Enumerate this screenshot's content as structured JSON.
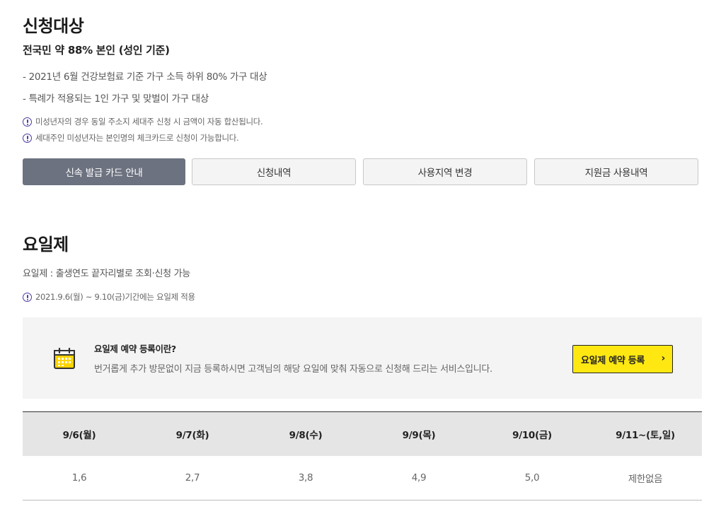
{
  "eligibility": {
    "title": "신청대상",
    "subtitle": "전국민 약 88% 본인 (성인 기준)",
    "bullets": [
      "- 2021년 6월 건강보험료 기준 가구 소득 하위 80% 가구 대상",
      "- 특례가 적용되는 1인 가구 및 맞벌이 가구 대상"
    ],
    "notes": [
      "미성년자의 경우 동일 주소지 세대주 신청 시 금액이 자동 합산됩니다.",
      "세대주인 미성년자는 본인명의 체크카드로 신청이 가능합니다."
    ]
  },
  "tabs": [
    {
      "label": "신속 발급 카드 안내",
      "active": true
    },
    {
      "label": "신청내역",
      "active": false
    },
    {
      "label": "사용지역 변경",
      "active": false
    },
    {
      "label": "지원금 사용내역",
      "active": false
    }
  ],
  "weekday_rule": {
    "title": "요일제",
    "description": "요일제 : 출생연도 끝자리별로 조회·신청 가능",
    "note": "2021.9.6(월) ~ 9.10(금)기간에는 요일제 적용"
  },
  "promo": {
    "icon": "calendar-icon",
    "title": "요일제 예약 등록이란?",
    "description": "번거롭게 추가 방문없이 지금 등록하시면 고객님의 해당 요일에 맞춰 자동으로 신청해 드리는 서비스입니다.",
    "button_label": "요일제 예약 등록",
    "accent_color": "#ffe812"
  },
  "schedule_table": {
    "headers": [
      "9/6(월)",
      "9/7(화)",
      "9/8(수)",
      "9/9(목)",
      "9/10(금)",
      "9/11~(토,일)"
    ],
    "values": [
      "1,6",
      "2,7",
      "3,8",
      "4,9",
      "5,0",
      "제한없음"
    ]
  }
}
